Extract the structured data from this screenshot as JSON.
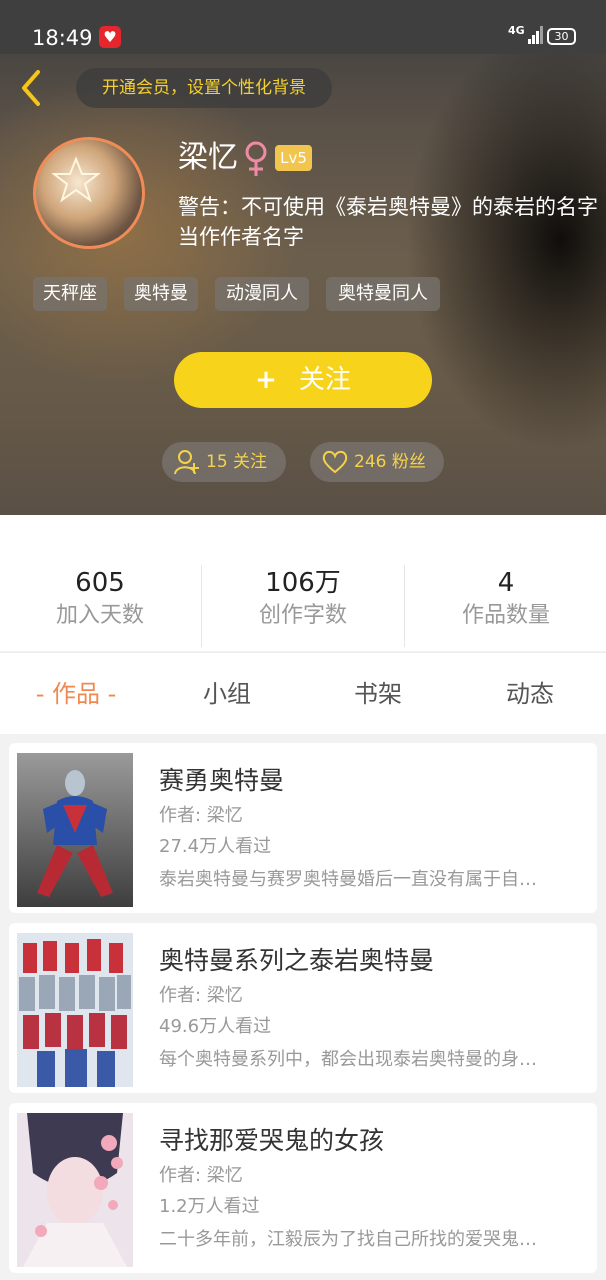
{
  "status_bar": {
    "time": "18:49",
    "network": "4G",
    "battery": "30"
  },
  "header": {
    "vip_prompt": "开通会员，设置个性化背景"
  },
  "profile": {
    "name": "梁忆",
    "level": "Lv5",
    "bio": "警告：不可使用《泰岩奥特曼》的泰岩的名字当作作者名字",
    "tags": [
      "天秤座",
      "奥特曼",
      "动漫同人",
      "奥特曼同人"
    ],
    "follow_label": "关注",
    "following": "15 关注",
    "fans": "246 粉丝"
  },
  "stats": [
    {
      "value": "605",
      "label": "加入天数"
    },
    {
      "value": "106万",
      "label": "创作字数"
    },
    {
      "value": "4",
      "label": "作品数量"
    }
  ],
  "tabs": [
    "- 作品 -",
    "小组",
    "书架",
    "动态"
  ],
  "books": [
    {
      "title": "赛勇奥特曼",
      "author": "作者: 梁忆",
      "views": "27.4万人看过",
      "desc": "泰岩奥特曼与赛罗奥特曼婚后一直没有属于自…"
    },
    {
      "title": "奥特曼系列之泰岩奥特曼",
      "author": "作者: 梁忆",
      "views": "49.6万人看过",
      "desc": "每个奥特曼系列中，都会出现泰岩奥特曼的身…"
    },
    {
      "title": "寻找那爱哭鬼的女孩",
      "author": "作者: 梁忆",
      "views": "1.2万人看过",
      "desc": "二十多年前，江毅辰为了找自己所找的爱哭鬼…"
    }
  ],
  "colors": {
    "accent": "#f7d41b",
    "tab_active": "#f0884f",
    "badge": "#f2c54e",
    "avatar_ring": "#f08c57"
  },
  "icons": [
    "back-arrow-icon",
    "female-icon",
    "add-user-icon",
    "heart-icon"
  ]
}
